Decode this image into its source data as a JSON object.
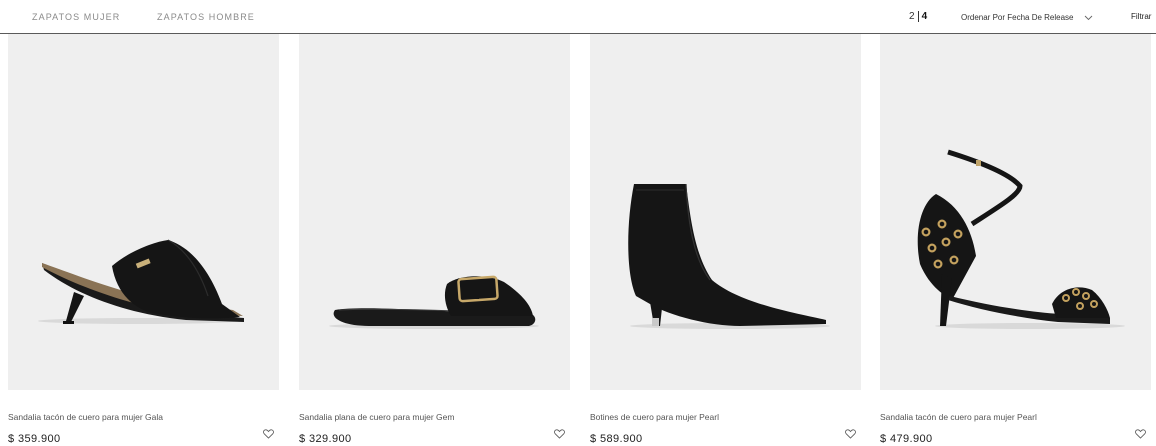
{
  "nav": {
    "mujer": "ZAPATOS MUJER",
    "hombre": "ZAPATOS HOMBRE"
  },
  "grid": {
    "options": [
      "2",
      "4"
    ],
    "active": "4"
  },
  "sort": {
    "label": "Ordenar Por Fecha De Release"
  },
  "filter": {
    "label": "Filtrar"
  },
  "products": [
    {
      "name": "Sandalia tacón de cuero para mujer Gala",
      "price": "$ 359.900",
      "image": "black-leather-heeled-mule"
    },
    {
      "name": "Sandalia plana de cuero para mujer Gem",
      "price": "$ 329.900",
      "image": "black-leather-flat-slide-buckle"
    },
    {
      "name": "Botines de cuero para mujer Pearl",
      "price": "$ 589.900",
      "image": "black-leather-ankle-boot"
    },
    {
      "name": "Sandalia tacón de cuero para mujer Pearl",
      "price": "$ 479.900",
      "image": "black-leather-grommet-heeled-sandal"
    }
  ],
  "colors": {
    "photo_bg": "#efefef",
    "shoe": "#151515",
    "divider": "#5a5a5a"
  }
}
